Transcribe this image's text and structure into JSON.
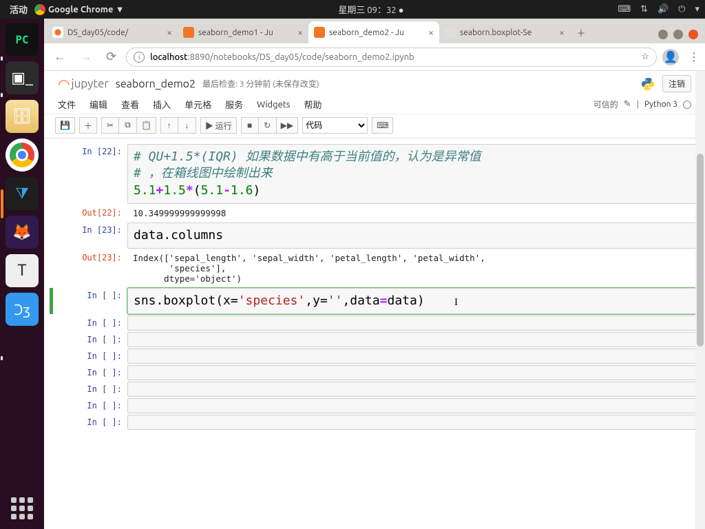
{
  "gnome": {
    "activities": "活动",
    "app_label": "Google Chrome ▼",
    "clock": "星期三 09：32 ●"
  },
  "tabs": [
    {
      "title": "DS_day05/code/",
      "fav": "fv-jup",
      "active": false
    },
    {
      "title": "seaborn_demo1 - Ju",
      "fav": "fv-jb",
      "active": false
    },
    {
      "title": "seaborn_demo2 - Ju",
      "fav": "fv-jb",
      "active": true
    },
    {
      "title": "seaborn.boxplot-Se",
      "fav": "fv-star",
      "active": false
    }
  ],
  "url": {
    "host": "localhost",
    "port": ":8890",
    "path": "/notebooks/DS_day05/code/seaborn_demo2.ipynb"
  },
  "notebook": {
    "brand": "jupyter",
    "title": "seaborn_demo2",
    "checkpoint": "最后检查: 3 分钟前  (未保存改变)",
    "logout": "注销",
    "trusted": "可信的",
    "kernel": "Python 3"
  },
  "menu": {
    "file": "文件",
    "edit": "编辑",
    "view": "查看",
    "insert": "插入",
    "cell": "单元格",
    "kernel": "服务",
    "widgets": "Widgets",
    "help": "帮助"
  },
  "toolbar": {
    "run": "▶ 运行",
    "celltype": "代码"
  },
  "cells": {
    "c22_prompt": "In [22]:",
    "c22_code_l1": "# QU+1.5*(IQR) 如果数据中有高于当前值的，认为是异常值",
    "c22_code_l2": "# ，在箱线图中绘制出来",
    "c22_num1": "5.1",
    "c22_num2": "1.5",
    "c22_num3": "5.1",
    "c22_num4": "1.6",
    "c22_out_prompt": "Out[22]:",
    "c22_out": "10.349999999999998",
    "c23_prompt": "In [23]:",
    "c23_code": "data.columns",
    "c23_out_prompt": "Out[23]:",
    "c23_out": "Index(['sepal_length', 'sepal_width', 'petal_length', 'petal_width',\n       'species'],\n      dtype='object')",
    "active_prompt": "In [ ]:",
    "active_pre": "sns.boxplot(x=",
    "active_str1": "'species'",
    "active_mid": ",y=",
    "active_str2": "''",
    "active_post1": ",data",
    "active_post2": "data)",
    "empty_prompt": "In [ ]:"
  }
}
